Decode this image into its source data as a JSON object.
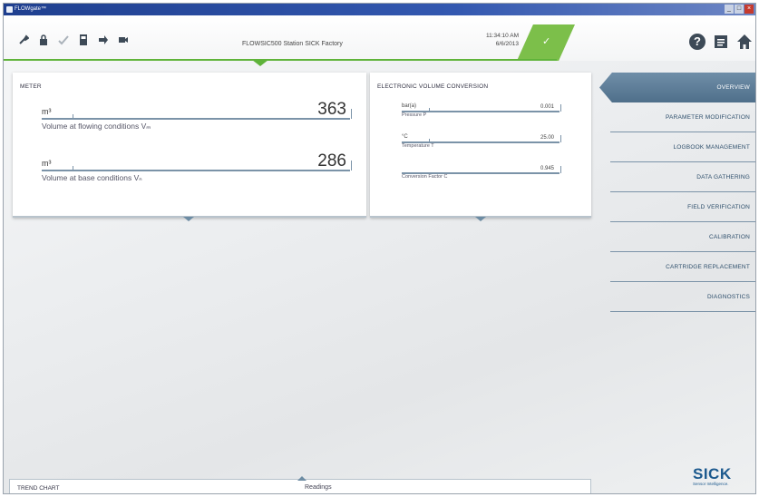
{
  "window": {
    "title": "FLOWgate™"
  },
  "header": {
    "station": "FLOWSIC500 Station SICK Factory",
    "time": "11:34:10 AM",
    "date": "6/6/2013",
    "status_icon": "checkmark-icon",
    "right_icons": [
      "help-icon",
      "document-icon",
      "home-icon"
    ],
    "tool_icons": [
      "wrench-icon",
      "lock-icon",
      "tick-icon",
      "device-icon",
      "export-icon",
      "camera-icon"
    ]
  },
  "meter": {
    "title": "METER",
    "rows": [
      {
        "unit": "m³",
        "value": "363",
        "label": "Volume at flowing conditions Vₘ"
      },
      {
        "unit": "m³",
        "value": "286",
        "label": "Volume at base conditions Vₙ"
      }
    ]
  },
  "evc": {
    "title": "ELECTRONIC VOLUME CONVERSION",
    "rows": [
      {
        "unit": "bar(a)",
        "value": "0.001",
        "label": "Pressure P"
      },
      {
        "unit": "°C",
        "value": "25.00",
        "label": "Temperature T"
      },
      {
        "unit": "",
        "value": "0.945",
        "label": "Conversion Factor C"
      }
    ]
  },
  "nav": {
    "items": [
      "OVERVIEW",
      "PARAMETER MODIFICATION",
      "LOGBOOK MANAGEMENT",
      "DATA GATHERING",
      "FIELD VERIFICATION",
      "CALIBRATION",
      "CARTRIDGE REPLACEMENT",
      "DIAGNOSTICS"
    ],
    "active_index": 0
  },
  "trend": {
    "title": "TREND CHART",
    "readings": "Readings"
  },
  "brand": {
    "name": "SICK",
    "tagline": "Sensor Intelligence.",
    "color": "#1d5a8e"
  },
  "colors": {
    "accent_green": "#5fb33a",
    "nav_active": "#5a7893"
  }
}
